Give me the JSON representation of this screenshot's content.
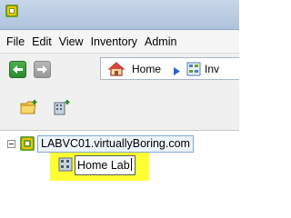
{
  "menu": {
    "items": [
      "File",
      "Edit",
      "View",
      "Inventory",
      "Admin"
    ]
  },
  "navigation": {
    "breadcrumb_home": "Home",
    "breadcrumb_next": "Inv"
  },
  "tree": {
    "root_label": "LABVC01.virtuallyBoring.com",
    "new_item_value": "Home Lab"
  },
  "icons": {
    "app": "vsphere-app-icon",
    "back": "back-arrow-icon",
    "forward": "forward-arrow-icon",
    "home": "home-icon",
    "inventory": "inventory-icon",
    "new_folder": "new-folder-icon",
    "new_datacenter": "new-datacenter-icon",
    "vcenter": "vcenter-icon",
    "datacenter": "datacenter-icon"
  },
  "colors": {
    "highlight": "#ffff33",
    "back_button": "#3c9e3c",
    "selection_border": "#7fa7d9"
  }
}
